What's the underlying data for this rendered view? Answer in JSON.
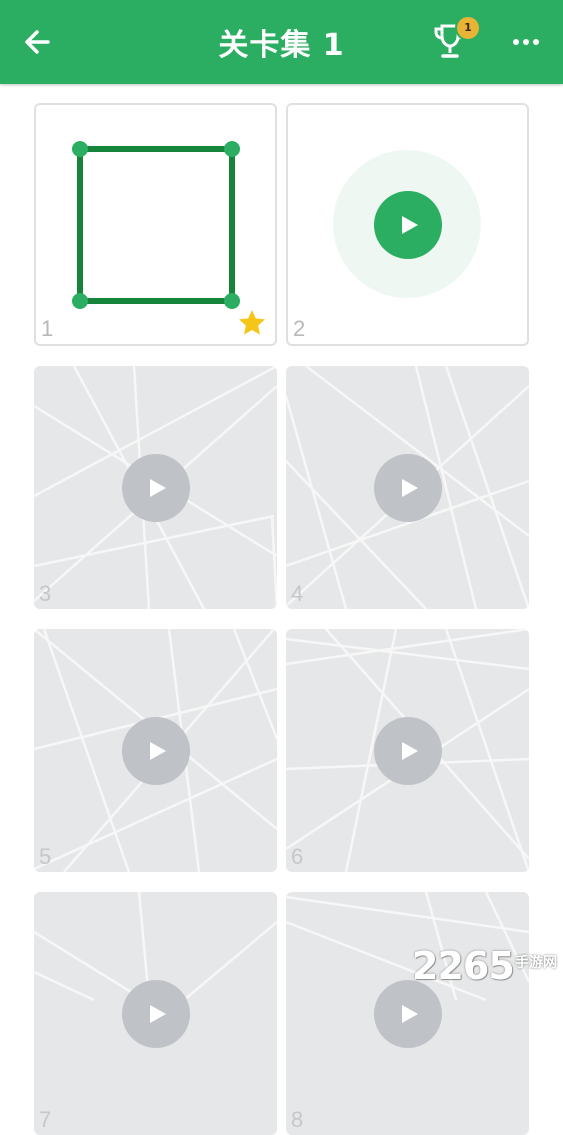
{
  "header": {
    "title": "关卡集 1",
    "back_icon": "arrow-left-icon",
    "trophy_icon": "trophy-icon",
    "trophy_badge": "1",
    "more_icon": "more-horizontal-icon",
    "background_color": "#2bae61"
  },
  "levels": [
    {
      "number": "1",
      "state": "completed",
      "stars": 1
    },
    {
      "number": "2",
      "state": "current"
    },
    {
      "number": "3",
      "state": "locked"
    },
    {
      "number": "4",
      "state": "locked"
    },
    {
      "number": "5",
      "state": "locked"
    },
    {
      "number": "6",
      "state": "locked"
    },
    {
      "number": "7",
      "state": "locked"
    },
    {
      "number": "8",
      "state": "locked"
    }
  ],
  "colors": {
    "accent": "#2bae61",
    "puzzle_line": "#16853b",
    "locked_tile": "#e6e7e8",
    "locked_play": "#bfc3c7",
    "star": "#f5c518"
  },
  "watermark": {
    "text": "2265",
    "subtext": "手游网"
  }
}
